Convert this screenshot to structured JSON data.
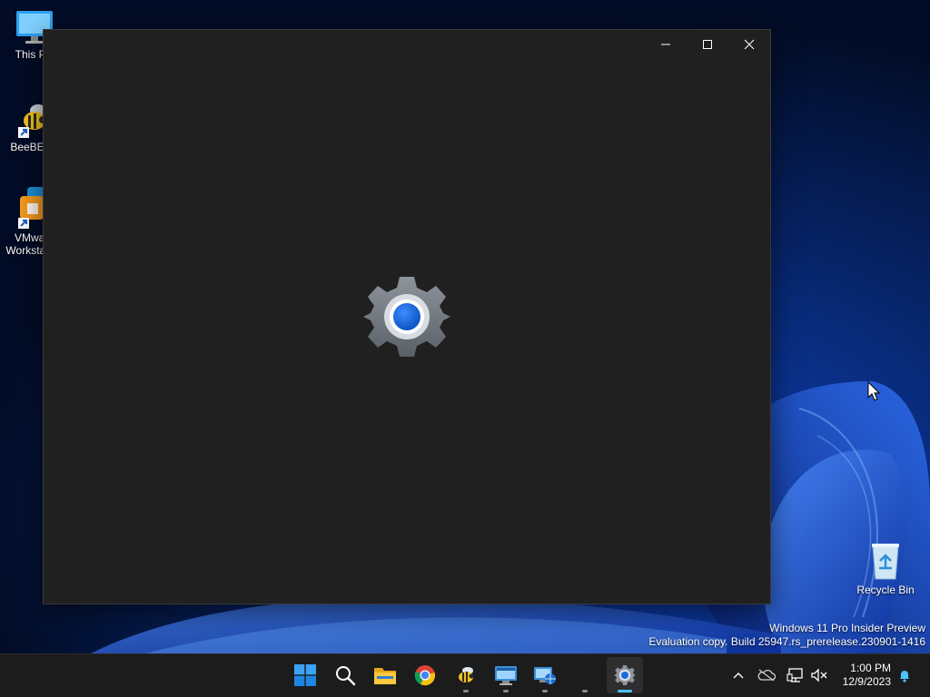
{
  "desktop": {
    "icons": [
      {
        "label": "This PC",
        "icon": "monitor-icon"
      },
      {
        "label": "BeeBEEP",
        "icon": "bee-icon"
      },
      {
        "label": "VMware Workstation",
        "icon": "vmware-icon"
      },
      {
        "label": "Recycle Bin",
        "icon": "recycle-bin-icon"
      }
    ],
    "watermark": {
      "line1": "Windows 11 Pro Insider Preview",
      "line2": "Evaluation copy. Build 25947.rs_prerelease.230901-1416"
    }
  },
  "window": {
    "app": "Settings",
    "splash_icon": "gear-icon",
    "caption": {
      "minimize": "minimize-icon",
      "maximize": "maximize-icon",
      "close": "close-icon"
    }
  },
  "taskbar": {
    "items": [
      {
        "name": "Start",
        "icon": "windows-logo-icon"
      },
      {
        "name": "Search",
        "icon": "search-icon"
      },
      {
        "name": "File Explorer",
        "icon": "folder-icon"
      },
      {
        "name": "Google Chrome",
        "icon": "chrome-icon"
      },
      {
        "name": "BeeBEEP",
        "icon": "bee-icon"
      },
      {
        "name": "Remote Desktop",
        "icon": "remote-desktop-icon"
      },
      {
        "name": "Network",
        "icon": "network-globe-icon"
      },
      {
        "name": "App",
        "icon": "app-icon"
      },
      {
        "name": "Settings",
        "icon": "gear-icon",
        "active": true
      }
    ],
    "tray": [
      "chevron-up-icon",
      "onedrive-icon",
      "network-icon",
      "volume-muted-icon"
    ],
    "clock": {
      "time": "1:00 PM",
      "date": "12/9/2023"
    },
    "notification_icon": "bell-icon"
  },
  "colors": {
    "accent": "#4cc2ff",
    "window_bg": "#202020",
    "taskbar_bg": "#1c1c1c",
    "desktop_bg": "#041436"
  }
}
